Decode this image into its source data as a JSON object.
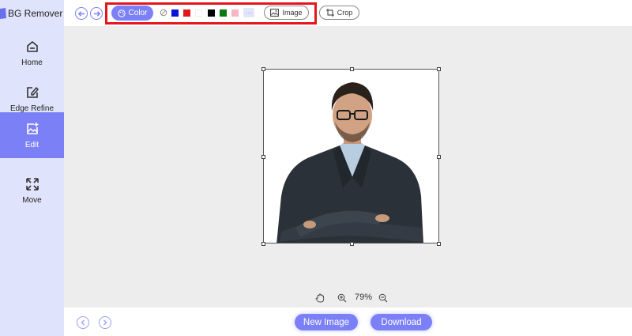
{
  "app": {
    "title": "BG Remover"
  },
  "sidebar": {
    "items": [
      {
        "label": "Home",
        "icon": "home-icon"
      },
      {
        "label": "Edge Refine",
        "icon": "edit-pencil-icon"
      },
      {
        "label": "Edit",
        "icon": "image-edit-icon",
        "active": true
      },
      {
        "label": "Move",
        "icon": "move-arrows-icon"
      }
    ]
  },
  "toolbar": {
    "color_label": "Color",
    "image_label": "Image",
    "crop_label": "Crop",
    "swatches": [
      "none",
      "#0a14d6",
      "#e3161c",
      "#ffffff",
      "#000000",
      "#0b7a12",
      "#f6b6c4"
    ],
    "more_label": "···",
    "highlight_color": "#e3161c"
  },
  "zoom": {
    "level": "79%"
  },
  "bottom": {
    "new_image_label": "New Image",
    "download_label": "Download"
  },
  "theme": {
    "accent": "#7b80f7",
    "sidebar_bg": "#dfe3fb",
    "canvas_bg": "#ededed"
  }
}
